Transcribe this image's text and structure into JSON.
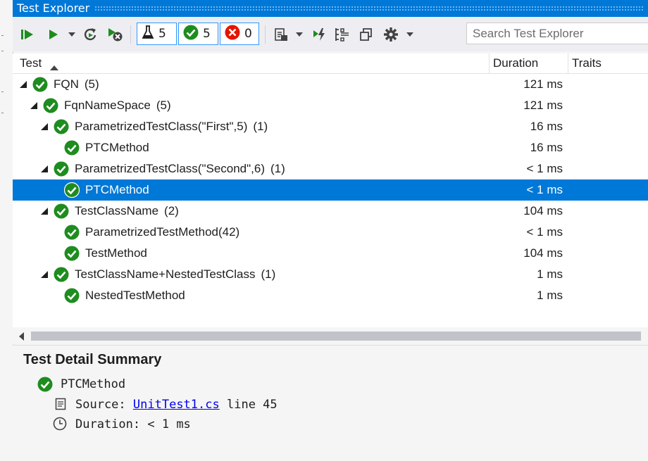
{
  "window": {
    "title": "Test Explorer"
  },
  "toolbar": {
    "icons": [
      "run-all-icon",
      "run-icon",
      "dropdown-icon",
      "refresh-icon",
      "cancel-icon",
      "playlist-icon",
      "group-icon",
      "run-on-build-icon",
      "columns-icon",
      "collapse-icon",
      "settings-icon"
    ],
    "counts": {
      "total": "5",
      "passed": "5",
      "failed": "0"
    }
  },
  "search": {
    "placeholder": "Search Test Explorer",
    "value": ""
  },
  "columns": {
    "test": "Test",
    "duration": "Duration",
    "traits": "Traits"
  },
  "colors": {
    "accent": "#0078d7",
    "pass": "#1e8c1e",
    "fail": "#e51400"
  },
  "tree": [
    {
      "name": "FQN",
      "count": "(5)",
      "duration": "121 ms",
      "level": 0,
      "expanded": true,
      "selected": false
    },
    {
      "name": "FqnNameSpace",
      "count": "(5)",
      "duration": "121 ms",
      "level": 1,
      "expanded": true,
      "selected": false
    },
    {
      "name": "ParametrizedTestClass(\"First\",5)",
      "count": "(1)",
      "duration": "16 ms",
      "level": 2,
      "expanded": true,
      "selected": false
    },
    {
      "name": "PTCMethod",
      "count": "",
      "duration": "16 ms",
      "level": 3,
      "expanded": false,
      "selected": false
    },
    {
      "name": "ParametrizedTestClass(\"Second\",6)",
      "count": "(1)",
      "duration": "< 1 ms",
      "level": 2,
      "expanded": true,
      "selected": false
    },
    {
      "name": "PTCMethod",
      "count": "",
      "duration": "< 1 ms",
      "level": 3,
      "expanded": false,
      "selected": true
    },
    {
      "name": "TestClassName",
      "count": "(2)",
      "duration": "104 ms",
      "level": 2,
      "expanded": true,
      "selected": false
    },
    {
      "name": "ParametrizedTestMethod(42)",
      "count": "",
      "duration": "< 1 ms",
      "level": 3,
      "expanded": false,
      "selected": false
    },
    {
      "name": "TestMethod",
      "count": "",
      "duration": "104 ms",
      "level": 3,
      "expanded": false,
      "selected": false
    },
    {
      "name": "TestClassName+NestedTestClass",
      "count": "(1)",
      "duration": "1 ms",
      "level": 2,
      "expanded": true,
      "selected": false
    },
    {
      "name": "NestedTestMethod",
      "count": "",
      "duration": "1 ms",
      "level": 3,
      "expanded": false,
      "selected": false
    }
  ],
  "detail": {
    "title": "Test Detail Summary",
    "test_name": "PTCMethod",
    "source_label": "Source:",
    "source_file": "UnitTest1.cs",
    "source_line": "line 45",
    "duration_label": "Duration:",
    "duration_value": "< 1 ms"
  }
}
